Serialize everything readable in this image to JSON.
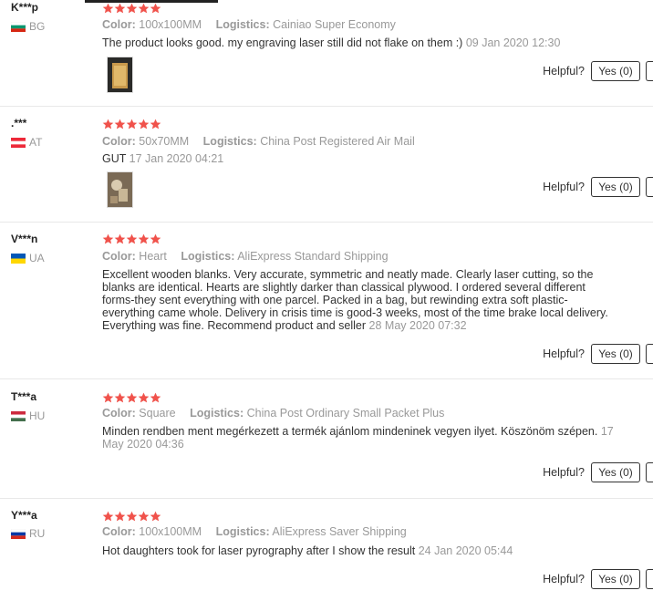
{
  "colors": {
    "star": "#f0524b",
    "muted": "#999999",
    "text": "#333333"
  },
  "reviews": [
    {
      "user": "K***p",
      "country": "BG",
      "flag": "bulgaria-flag",
      "k1": "Color:",
      "v1": "100x100MM",
      "k2": "Logistics:",
      "v2": "Cainiao Super Economy",
      "text": "The product looks good. my engraving laser still did not flake on them :)",
      "date": "09 Jan 2020 12:30",
      "helpful": "Helpful?",
      "yes": "Yes (0)"
    },
    {
      "user": ".***",
      "country": "AT",
      "flag": "austria-flag",
      "k1": "Color:",
      "v1": "50x70MM",
      "k2": "Logistics:",
      "v2": "China Post Registered Air Mail",
      "text": "GUT",
      "date": "17 Jan 2020 04:21",
      "helpful": "Helpful?",
      "yes": "Yes (0)"
    },
    {
      "user": "V***n",
      "country": "UA",
      "flag": "ukraine-flag",
      "k1": "Color:",
      "v1": "Heart",
      "k2": "Logistics:",
      "v2": "AliExpress Standard Shipping",
      "text": "Excellent wooden blanks. Very accurate, symmetric and neatly made. Clearly laser cutting, so the blanks are identical. Hearts are slightly darker than classical plywood. I ordered several different forms-they sent everything with one parcel. Packed in a bag, but rewinding extra soft plastic-everything came whole. Delivery in crisis time is good-3 weeks, most of the time brake local delivery. Everything was fine. Recommend product and seller",
      "date": "28 May 2020 07:32",
      "helpful": "Helpful?",
      "yes": "Yes (0)"
    },
    {
      "user": "T***a",
      "country": "HU",
      "flag": "hungary-flag",
      "k1": "Color:",
      "v1": "Square",
      "k2": "Logistics:",
      "v2": "China Post Ordinary Small Packet Plus",
      "text": "Minden rendben ment megérkezett a termék ajánlom mindeninek vegyen ilyet. Köszönöm szépen.",
      "date": "17 May 2020 04:36",
      "helpful": "Helpful?",
      "yes": "Yes (0)"
    },
    {
      "user": "Y***a",
      "country": "RU",
      "flag": "russia-flag",
      "k1": "Color:",
      "v1": "100x100MM",
      "k2": "Logistics:",
      "v2": "AliExpress Saver Shipping",
      "text": "Hot daughters took for laser pyrography after I show the result",
      "date": "24 Jan 2020 05:44",
      "helpful": "Helpful?",
      "yes": "Yes (0)"
    }
  ]
}
